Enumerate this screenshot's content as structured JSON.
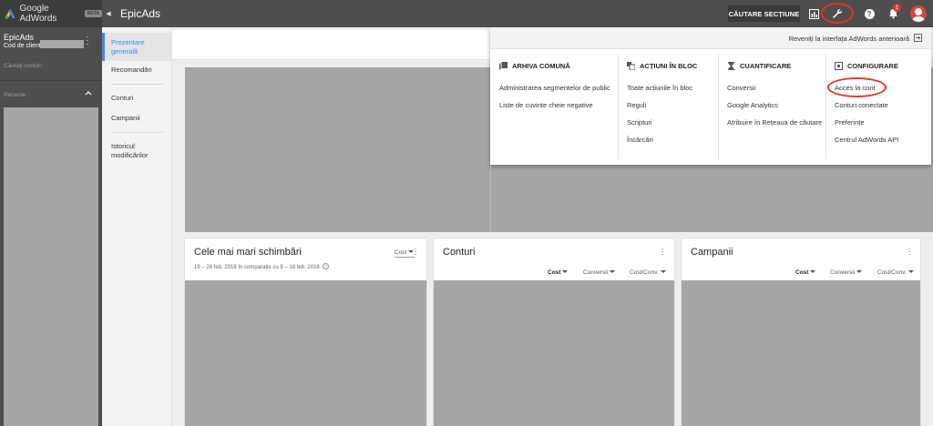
{
  "topbar": {
    "brand": "Google AdWords",
    "beta": "BETA",
    "app_name": "EpicAds",
    "search_sections": "CĂUTARE SECȚIUNE",
    "notification_count": "1",
    "help_glyph": "?"
  },
  "account": {
    "name": "EpicAds",
    "client_label": "Cod de client:",
    "search_placeholder": "Căutați conturi",
    "recent_label": "Recente"
  },
  "nav": {
    "items": [
      {
        "label": "Prezentare generală"
      },
      {
        "label": "Recomandări"
      },
      {
        "label": "Conturi"
      },
      {
        "label": "Campanii"
      },
      {
        "label": "Istoricul modificărilor"
      }
    ]
  },
  "cards": {
    "changes": {
      "title": "Cele mai mari schimbări",
      "subtitle": "19 – 28 feb. 2018 în comparație cu 9 – 18 feb. 2018",
      "metric": "Cost"
    },
    "accounts": {
      "title": "Conturi",
      "columns": [
        "Cost",
        "Conversii",
        "Cost/Conv."
      ]
    },
    "campaigns": {
      "title": "Campanii",
      "columns": [
        "Cost",
        "Conversii",
        "Cost/Conv."
      ]
    }
  },
  "dropdown": {
    "revert_link": "Reveniți la interfața AdWords anterioară",
    "sections": [
      {
        "heading": "ARHIVA COMUNĂ",
        "icon": "library-icon",
        "links": [
          "Administrarea segmentelor de public",
          "Liste de cuvinte cheie negative"
        ]
      },
      {
        "heading": "ACȚIUNI ÎN BLOC",
        "icon": "copy-icon",
        "links": [
          "Toate acțiunile în bloc",
          "Reguli",
          "Scripturi",
          "Încărcări"
        ]
      },
      {
        "heading": "CUANTIFICARE",
        "icon": "hourglass-icon",
        "links": [
          "Conversii",
          "Google Analytics",
          "Atribuire în Rețeaua de căutare"
        ]
      },
      {
        "heading": "CONFIGURARE",
        "icon": "settings-box-icon",
        "links": [
          "Acces la cont",
          "Conturi conectate",
          "Preferințe",
          "Centrul AdWords API"
        ]
      }
    ]
  },
  "colors": {
    "topbar": "#4e4e4e",
    "brand_bg": "#3c3c3c",
    "accent": "#4285f4",
    "highlight_ring": "#e5322b",
    "avatar": "#db4437"
  }
}
